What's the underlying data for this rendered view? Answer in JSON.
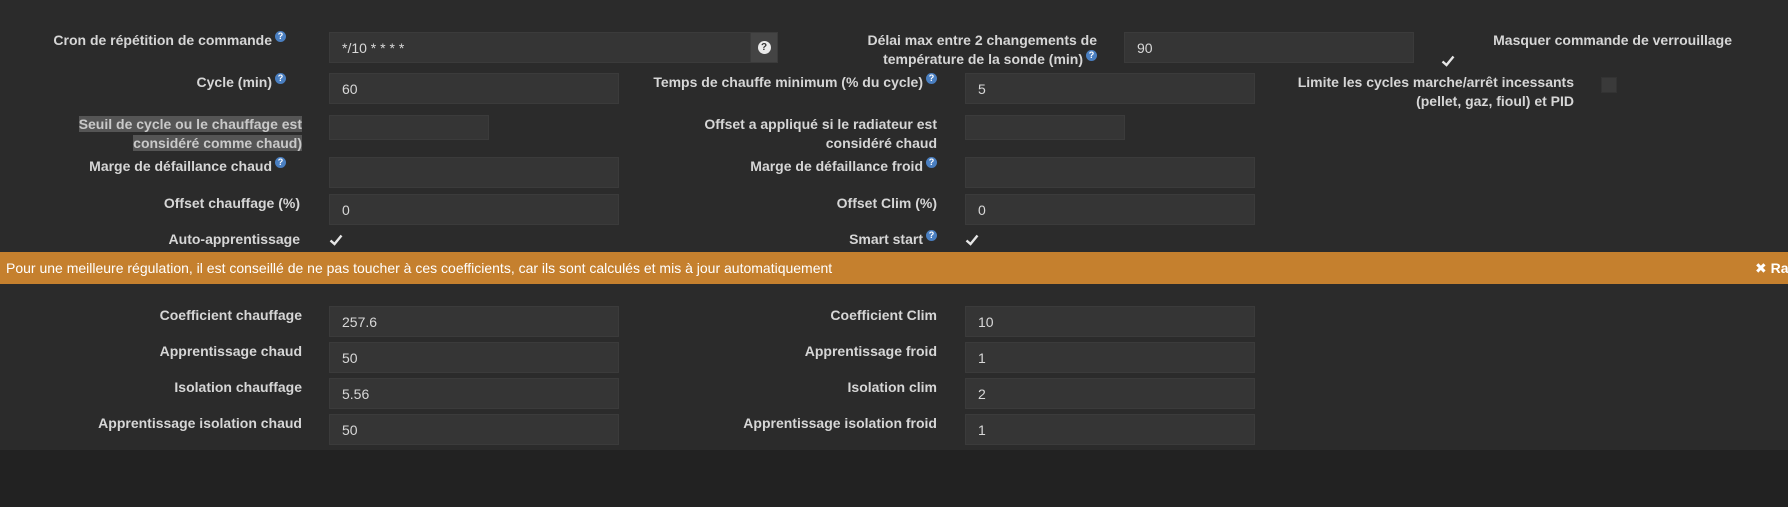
{
  "row_cron": {
    "label": "Cron de répétition de commande",
    "value": "*/10 * * * *",
    "addon_icon": "question-circle-icon"
  },
  "row_delai": {
    "label": "Délai max entre 2 changements de température de la sonde (min)",
    "value": "90"
  },
  "row_masquer": {
    "label": "Masquer commande de verrouillage",
    "checked": true
  },
  "row_cycle": {
    "label": "Cycle (min)",
    "value": "60"
  },
  "row_temps_chauffe": {
    "label": "Temps de chauffe minimum (% du cycle)",
    "value": "5"
  },
  "row_limite": {
    "label": "Limite les cycles marche/arrêt incessants (pellet, gaz, fioul) et PID",
    "checked": false
  },
  "row_seuil": {
    "label": "Seuil de cycle ou le chauffage est considéré comme chaud)",
    "value": ""
  },
  "row_offset_radiateur": {
    "label": "Offset a appliqué si le radiateur est considéré chaud",
    "value": ""
  },
  "row_marge_chaud": {
    "label": "Marge de défaillance chaud",
    "value": ""
  },
  "row_marge_froid": {
    "label": "Marge de défaillance froid",
    "value": ""
  },
  "row_offset_chauffage": {
    "label": "Offset chauffage (%)",
    "value": "0"
  },
  "row_offset_clim": {
    "label": "Offset Clim (%)",
    "value": "0"
  },
  "row_auto": {
    "label": "Auto-apprentissage",
    "checked": true
  },
  "row_smart": {
    "label": "Smart start",
    "checked": true
  },
  "banner": {
    "message": "Pour une meilleure régulation, il est conseillé de ne pas toucher à ces coefficients, car ils sont calculés et mis à jour automatiquement",
    "reset_label": "✖ RaZ",
    "color": "#c5802e"
  },
  "coef_chauffage": {
    "label": "Coefficient chauffage",
    "value": "257.6"
  },
  "coef_clim": {
    "label": "Coefficient Clim",
    "value": "10"
  },
  "appr_chaud": {
    "label": "Apprentissage chaud",
    "value": "50"
  },
  "appr_froid": {
    "label": "Apprentissage froid",
    "value": "1"
  },
  "iso_chauffage": {
    "label": "Isolation chauffage",
    "value": "5.56"
  },
  "iso_clim": {
    "label": "Isolation clim",
    "value": "2"
  },
  "appr_iso_chaud": {
    "label": "Apprentissage isolation chaud",
    "value": "50"
  },
  "appr_iso_froid": {
    "label": "Apprentissage isolation froid",
    "value": "1"
  },
  "help_glyph": "?",
  "colors": {
    "background": "#2b2b2b",
    "input": "#353535",
    "help_icon": "#4a7fc1",
    "highlight": "#555555"
  }
}
